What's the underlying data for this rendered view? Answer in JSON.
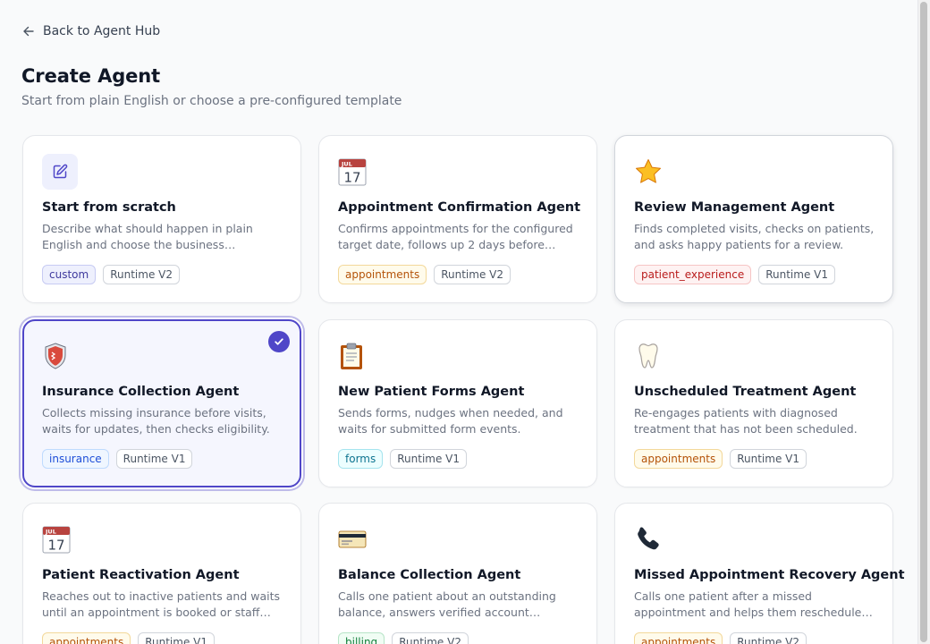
{
  "nav": {
    "back_label": "Back to Agent Hub"
  },
  "header": {
    "title": "Create Agent",
    "subtitle": "Start from plain English or choose a pre-configured template"
  },
  "cards": [
    {
      "title": "Start from scratch",
      "description": "Describe what should happen in plain English and choose the business capabilities it can use.",
      "icon": "pencil-edit-icon",
      "tags": [
        "custom",
        "Runtime V2"
      ],
      "state": "default"
    },
    {
      "title": "Appointment Confirmation Agent",
      "description": "Confirms appointments for the configured target date, follows up 2 days before…",
      "icon": "calendar-icon",
      "tags": [
        "appointments",
        "Runtime V2"
      ],
      "state": "default"
    },
    {
      "title": "Review Management Agent",
      "description": "Finds completed visits, checks on patients, and asks happy patients for a review.",
      "icon": "star-icon",
      "tags": [
        "patient_experience",
        "Runtime V1"
      ],
      "state": "hovered"
    },
    {
      "title": "Insurance Collection Agent",
      "description": "Collects missing insurance before visits, waits for updates, then checks eligibility.",
      "icon": "shield-icon",
      "tags": [
        "insurance",
        "Runtime V1"
      ],
      "state": "selected"
    },
    {
      "title": "New Patient Forms Agent",
      "description": "Sends forms, nudges when needed, and waits for submitted form events.",
      "icon": "clipboard-icon",
      "tags": [
        "forms",
        "Runtime V1"
      ],
      "state": "default"
    },
    {
      "title": "Unscheduled Treatment Agent",
      "description": "Re-engages patients with diagnosed treatment that has not been scheduled.",
      "icon": "tooth-icon",
      "tags": [
        "appointments",
        "Runtime V1"
      ],
      "state": "default"
    },
    {
      "title": "Patient Reactivation Agent",
      "description": "Reaches out to inactive patients and waits until an appointment is booked or staff takes over.",
      "icon": "calendar-icon",
      "tags": [
        "appointments",
        "Runtime V1"
      ],
      "state": "default"
    },
    {
      "title": "Balance Collection Agent",
      "description": "Calls one patient about an outstanding balance, answers verified account questions, and send…",
      "icon": "credit-card-icon",
      "tags": [
        "billing",
        "Runtime V2"
      ],
      "state": "default"
    },
    {
      "title": "Missed Appointment Recovery Agent",
      "description": "Calls one patient after a missed appointment and helps them reschedule during the verified…",
      "icon": "telephone-icon",
      "tags": [
        "appointments",
        "Runtime V2"
      ],
      "state": "default"
    }
  ],
  "calendar_icon": {
    "month": "JUL",
    "day": "17"
  }
}
